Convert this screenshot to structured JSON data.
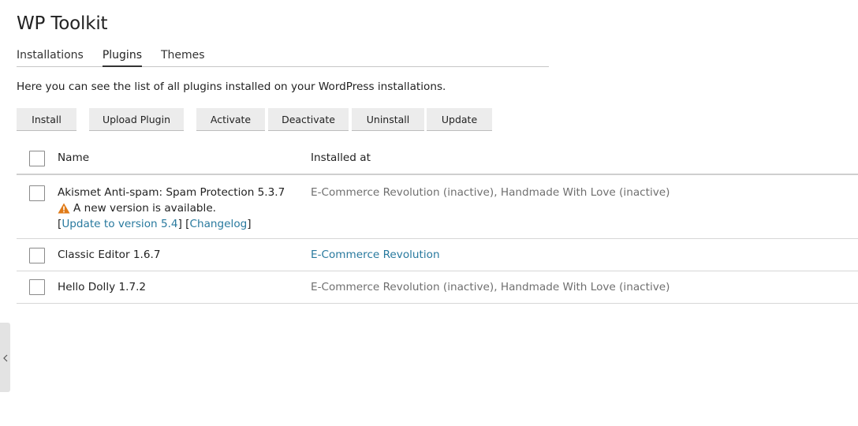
{
  "page": {
    "title": "WP Toolkit"
  },
  "tabs": [
    {
      "label": "Installations",
      "active": false
    },
    {
      "label": "Plugins",
      "active": true
    },
    {
      "label": "Themes",
      "active": false
    }
  ],
  "description": "Here you can see the list of all plugins installed on your WordPress installations.",
  "toolbar": {
    "install": "Install",
    "upload_plugin": "Upload Plugin",
    "activate": "Activate",
    "deactivate": "Deactivate",
    "uninstall": "Uninstall",
    "update": "Update"
  },
  "table": {
    "headers": {
      "name": "Name",
      "installed_at": "Installed at"
    },
    "rows": [
      {
        "name": "Akismet Anti-spam: Spam Protection 5.3.7",
        "notice": "A new version is available.",
        "update_link": "Update to version 5.4",
        "changelog_link": "Changelog",
        "installed_at": "E-Commerce Revolution (inactive), Handmade With Love (inactive)"
      },
      {
        "name": "Classic Editor 1.6.7",
        "installed_at": "E-Commerce Revolution"
      },
      {
        "name": "Hello Dolly 1.7.2",
        "installed_at": "E-Commerce Revolution (inactive), Handmade With Love (inactive)"
      }
    ]
  },
  "colors": {
    "link": "#28799e",
    "warning": "#e07b18",
    "muted_text": "#6f6f6f",
    "button_bg": "#ececec"
  },
  "icons": {
    "warning": "warning-triangle-icon",
    "side_handle": "chevron-left-icon"
  }
}
